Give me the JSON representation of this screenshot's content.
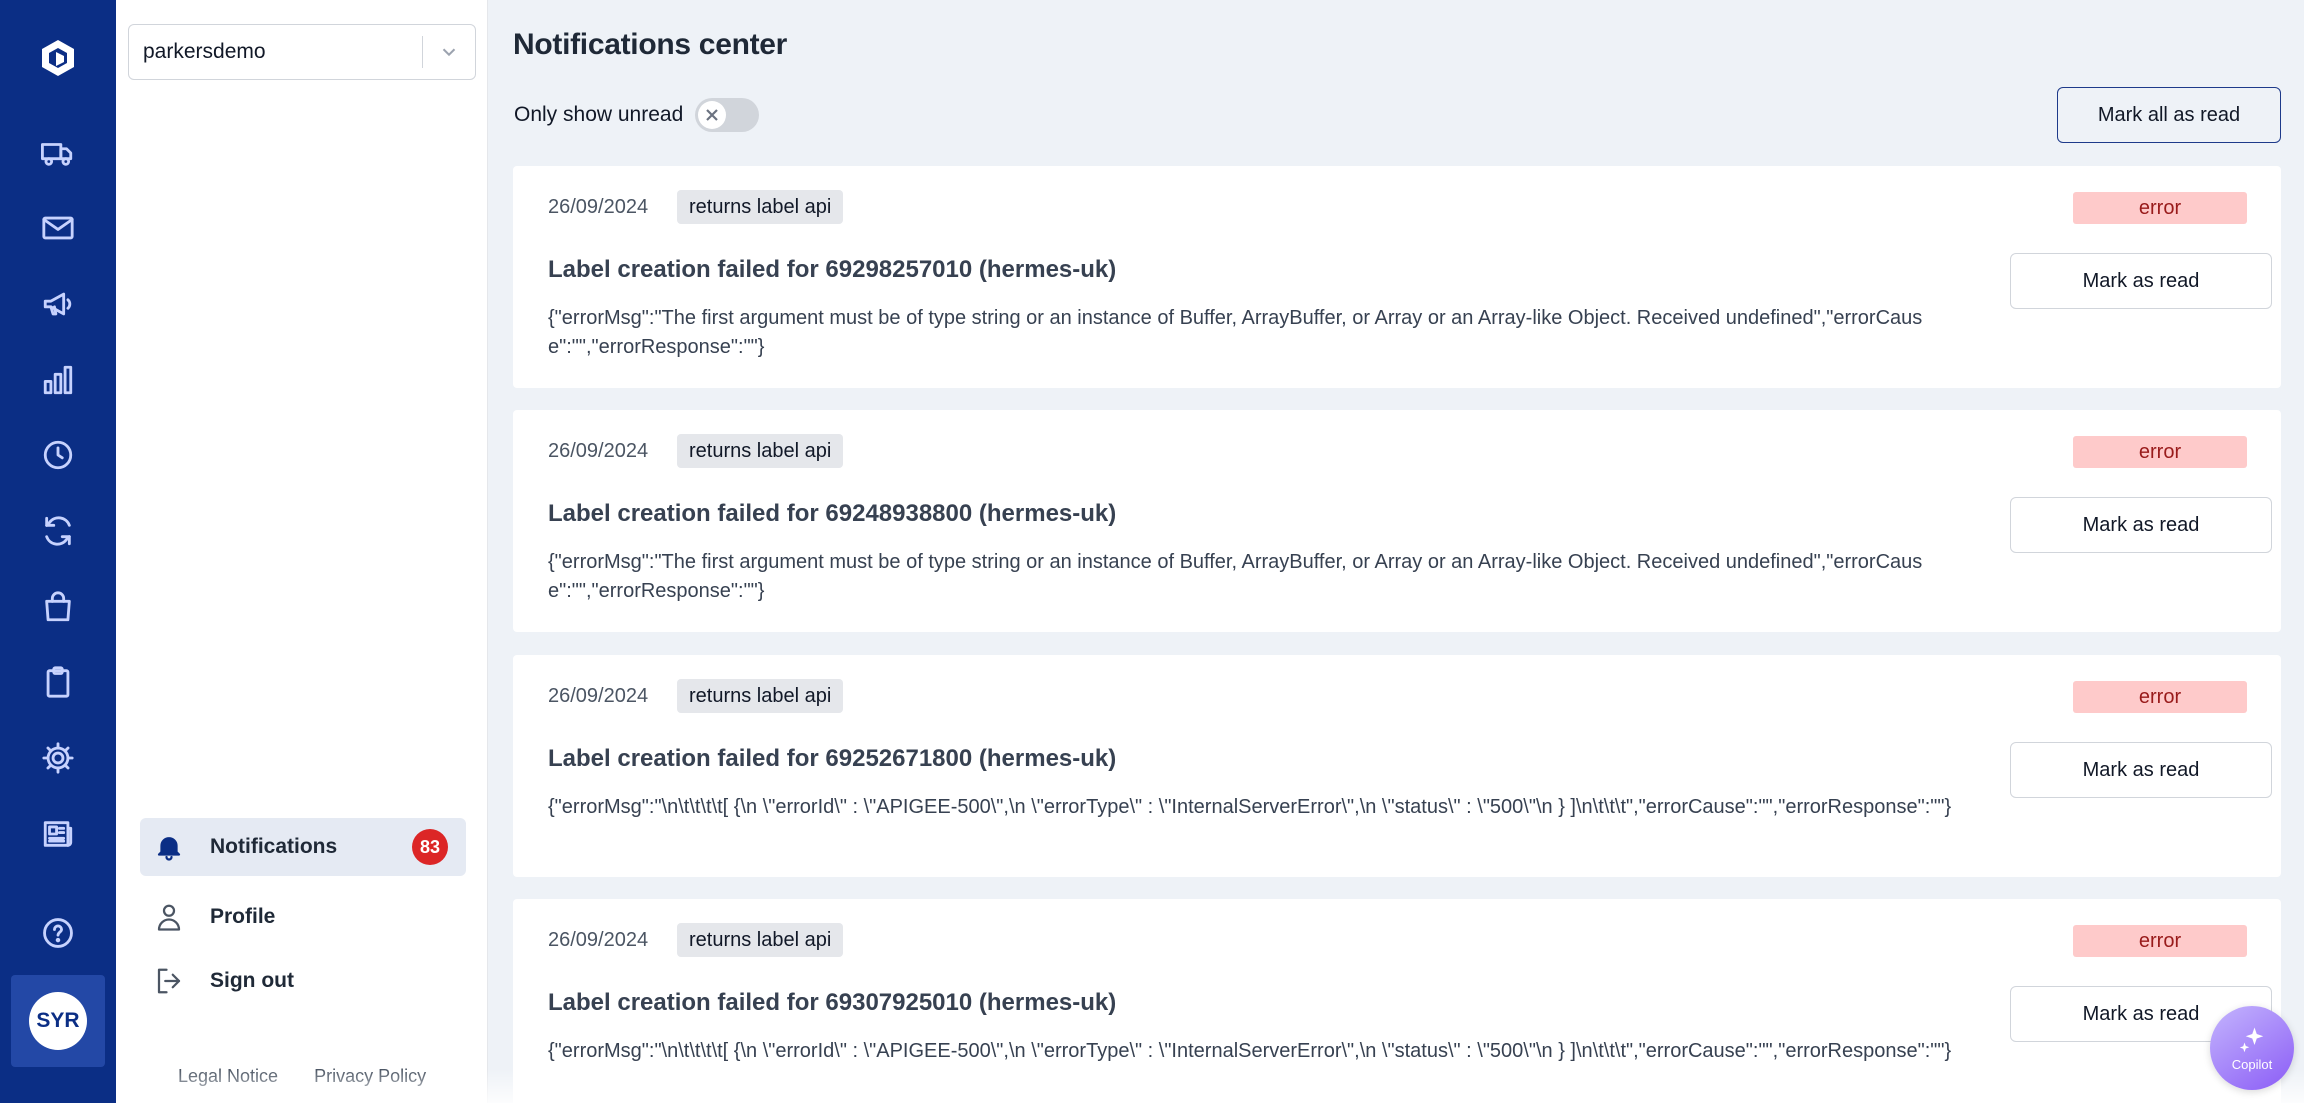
{
  "sidebar": {
    "org": "parkersdemo",
    "notifications_label": "Notifications",
    "notifications_count": "83",
    "profile_label": "Profile",
    "signout_label": "Sign out",
    "legal": "Legal Notice",
    "privacy": "Privacy Policy"
  },
  "user": {
    "initials": "SYR"
  },
  "main": {
    "title": "Notifications center",
    "only_unread_label": "Only show unread",
    "only_unread_enabled": false,
    "mark_all_label": "Mark all as read"
  },
  "notifications": [
    {
      "date": "26/09/2024",
      "tag": "returns label api",
      "status": "error",
      "title": "Label creation failed for 69298257010 (hermes-uk)",
      "message": "{\"errorMsg\":\"The first argument must be of type string or an instance of Buffer, ArrayBuffer, or Array or an Array-like Object. Received undefined\",\"errorCause\":\"\",\"errorResponse\":\"\"}",
      "action": "Mark as read"
    },
    {
      "date": "26/09/2024",
      "tag": "returns label api",
      "status": "error",
      "title": "Label creation failed for 69248938800 (hermes-uk)",
      "message": "{\"errorMsg\":\"The first argument must be of type string or an instance of Buffer, ArrayBuffer, or Array or an Array-like Object. Received undefined\",\"errorCause\":\"\",\"errorResponse\":\"\"}",
      "action": "Mark as read"
    },
    {
      "date": "26/09/2024",
      "tag": "returns label api",
      "status": "error",
      "title": "Label creation failed for 69252671800 (hermes-uk)",
      "message": "{\"errorMsg\":\"\\n\\t\\t\\t\\t[ {\\n \\\"errorId\\\" : \\\"APIGEE-500\\\",\\n \\\"errorType\\\" : \\\"InternalServerError\\\",\\n \\\"status\\\" : \\\"500\\\"\\n } ]\\n\\t\\t\\t\",\"errorCause\":\"\",\"errorResponse\":\"\"}",
      "action": "Mark as read"
    },
    {
      "date": "26/09/2024",
      "tag": "returns label api",
      "status": "error",
      "title": "Label creation failed for 69307925010 (hermes-uk)",
      "message": "{\"errorMsg\":\"\\n\\t\\t\\t\\t[ {\\n \\\"errorId\\\" : \\\"APIGEE-500\\\",\\n \\\"errorType\\\" : \\\"InternalServerError\\\",\\n \\\"status\\\" : \\\"500\\\"\\n } ]\\n\\t\\t\\t\",\"errorCause\":\"\",\"errorResponse\":\"\"}",
      "action": "Mark as read"
    }
  ],
  "copilot": {
    "label": "Copilot"
  }
}
